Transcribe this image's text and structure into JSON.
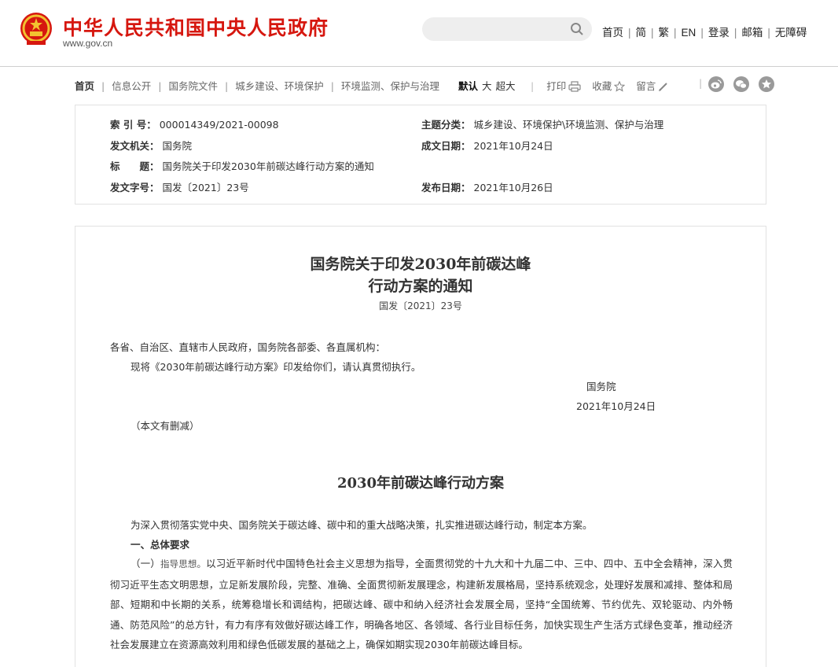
{
  "header": {
    "site_title": "中华人民共和国中央人民政府",
    "site_domain": "www.gov.cn",
    "search": {
      "value": "",
      "placeholder": ""
    },
    "links": [
      "首页",
      "简",
      "繁",
      "EN",
      "登录",
      "邮箱",
      "无障碍"
    ]
  },
  "breadcrumb": {
    "home": "首页",
    "items": [
      "信息公开",
      "国务院文件",
      "城乡建设、环境保护",
      "环境监测、保护与治理"
    ]
  },
  "toolbar": {
    "font_sizes": [
      "默认",
      "大",
      "超大"
    ],
    "print": "打印",
    "favorite": "收藏",
    "comment": "留言"
  },
  "meta": {
    "index_label": "索 引 号：",
    "index_value": "000014349/2021-00098",
    "topic_label": "主题分类：",
    "topic_value": "城乡建设、环境保护\\环境监测、保护与治理",
    "issuer_label": "发文机关：",
    "issuer_value": "国务院",
    "written_label": "成文日期：",
    "written_value": "2021年10月24日",
    "title_label": "标　　题：",
    "title_value": "国务院关于印发2030年前碳达峰行动方案的通知",
    "docnum_label": "发文字号：",
    "docnum_value": "国发〔2021〕23号",
    "published_label": "发布日期：",
    "published_value": "2021年10月26日"
  },
  "article": {
    "title_line1": "国务院关于印发2030年前碳达峰",
    "title_line2": "行动方案的通知",
    "doc_no": "国发〔2021〕23号",
    "salutation": "各省、自治区、直辖市人民政府，国务院各部委、各直属机构：",
    "notice": "现将《2030年前碳达峰行动方案》印发给你们，请认真贯彻执行。",
    "signer": "国务院",
    "sign_date": "2021年10月24日",
    "abridged": "（本文有删减）",
    "plan_title": "2030年前碳达峰行动方案",
    "intro": "为深入贯彻落实党中央、国务院关于碳达峰、碳中和的重大战略决策，扎实推进碳达峰行动，制定本方案。",
    "section1": "一、总体要求",
    "sub1_label": "（一）",
    "sub1_heading": "指导思想。",
    "sub1_text": "以习近平新时代中国特色社会主义思想为指导，全面贯彻党的十九大和十九届二中、三中、四中、五中全会精神，深入贯彻习近平生态文明思想，立足新发展阶段，完整、准确、全面贯彻新发展理念，构建新发展格局，坚持系统观念，处理好发展和减排、整体和局部、短期和中长期的关系，统筹稳增长和调结构，把碳达峰、碳中和纳入经济社会发展全局，坚持“全国统筹、节约优先、双轮驱动、内外畅通、防范风险”的总方针，有力有序有效做好碳达峰工作，明确各地区、各领域、各行业目标任务，加快实现生产生活方式绿色变革，推动经济社会发展建立在资源高效利用和绿色低碳发展的基础之上，确保如期实现2030年前碳达峰目标。"
  },
  "colors": {
    "brand_red": "#d6170f",
    "icon_gray": "#9a9a9a"
  },
  "icons": [
    "national-emblem-icon",
    "search-icon",
    "printer-icon",
    "star-icon",
    "pencil-icon",
    "weibo-icon",
    "wechat-icon",
    "favorite-icon"
  ]
}
